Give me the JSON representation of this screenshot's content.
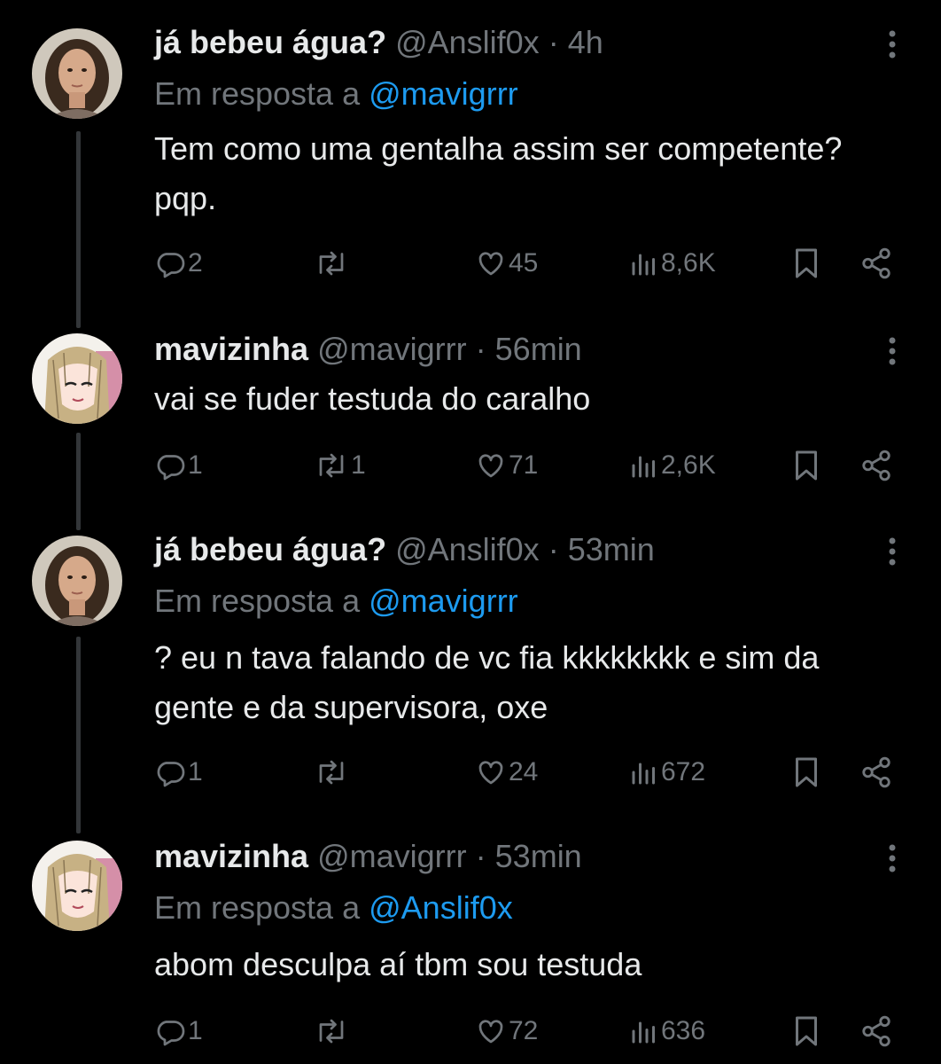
{
  "reply_prefix": "Em resposta a",
  "tweets": [
    {
      "name": "já bebeu água?",
      "handle": "@Anslif0x",
      "sep": "·",
      "time": "4h",
      "reply_to": "@mavigrrr",
      "text": "Tem como uma gentalha assim ser competente? pqp.",
      "replies": "2",
      "retweets": "",
      "likes": "45",
      "views": "8,6K"
    },
    {
      "name": "mavizinha",
      "handle": "@mavigrrr",
      "sep": "·",
      "time": "56min",
      "reply_to": "",
      "text": "vai se fuder testuda do caralho",
      "replies": "1",
      "retweets": "1",
      "likes": "71",
      "views": "2,6K"
    },
    {
      "name": "já bebeu água?",
      "handle": "@Anslif0x",
      "sep": "·",
      "time": "53min",
      "reply_to": "@mavigrrr",
      "text": "? eu n tava falando de vc fia kkkkkkkk e sim da gente e da supervisora, oxe",
      "replies": "1",
      "retweets": "",
      "likes": "24",
      "views": "672"
    },
    {
      "name": "mavizinha",
      "handle": "@mavigrrr",
      "sep": "·",
      "time": "53min",
      "reply_to": "@Anslif0x",
      "text": "abom desculpa aí tbm sou testuda",
      "replies": "1",
      "retweets": "",
      "likes": "72",
      "views": "636"
    }
  ],
  "icons": {
    "reply": "speech-bubble-icon",
    "retweet": "retweet-arrows-icon",
    "like": "heart-icon",
    "views": "bar-chart-icon",
    "bookmark": "bookmark-icon",
    "share": "share-icon",
    "more": "vertical-dots-icon"
  },
  "colors": {
    "background": "#000000",
    "text": "#e7e9ea",
    "secondary": "#71767b",
    "link": "#1d9bf0",
    "thread_line": "#333639"
  }
}
